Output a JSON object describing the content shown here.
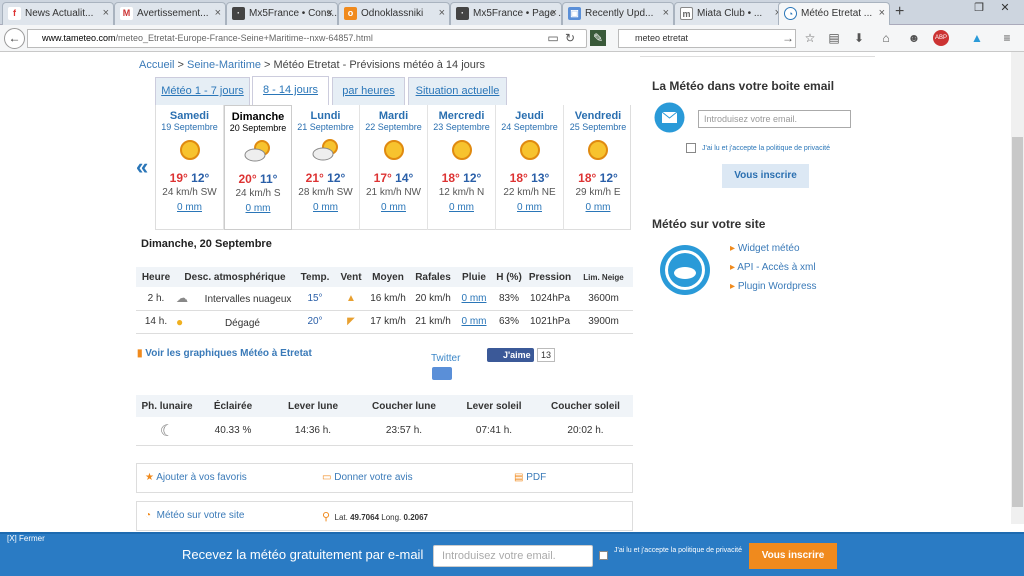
{
  "browser": {
    "tabs": [
      {
        "label": "News Actualit...",
        "icon": "news-icon",
        "color": "#d33"
      },
      {
        "label": "Avertissement...",
        "icon": "gmail-icon",
        "color": "#c33"
      },
      {
        "label": "Mx5France • Cons...",
        "icon": "mx5-icon",
        "color": "#444"
      },
      {
        "label": "Odnoklassniki",
        "icon": "ok-icon",
        "color": "#f08a1d"
      },
      {
        "label": "Mx5France • Page ...",
        "icon": "mx5-icon",
        "color": "#444"
      },
      {
        "label": "Recently Upd...",
        "icon": "photo-icon",
        "color": "#5a8fd8"
      },
      {
        "label": "Miata Club • ...",
        "icon": "mazda-icon",
        "color": "#666"
      },
      {
        "label": "Météo Etretat ...",
        "icon": "meteo-icon",
        "color": "#2a76b8"
      }
    ],
    "url_host": "www.tameteo.com",
    "url_path": "/meteo_Etretat-Europe-France-Seine+Maritime--nxw-64857.html",
    "search_value": "meteo etretat"
  },
  "breadcrumb": {
    "home": "Accueil",
    "sep": " > ",
    "region": "Seine-Maritime",
    "current": " > Météo Etretat - Prévisions météo à 14 jours"
  },
  "forecast_tabs": [
    "Météo 1 - 7 jours",
    "8 - 14 jours",
    "par heures",
    "Situation actuelle"
  ],
  "days": [
    {
      "name": "Samedi",
      "date": "19 Septembre",
      "max": "19°",
      "min": "12°",
      "wind": "24 km/h SW",
      "rain": "0 mm",
      "icon": "sun"
    },
    {
      "name": "Dimanche",
      "date": "20 Septembre",
      "max": "20°",
      "min": "11°",
      "wind": "24 km/h S",
      "rain": "0 mm",
      "icon": "sun-cloud"
    },
    {
      "name": "Lundi",
      "date": "21 Septembre",
      "max": "21°",
      "min": "12°",
      "wind": "28 km/h SW",
      "rain": "0 mm",
      "icon": "sun-cloud"
    },
    {
      "name": "Mardi",
      "date": "22 Septembre",
      "max": "17°",
      "min": "14°",
      "wind": "21 km/h NW",
      "rain": "0 mm",
      "icon": "sun"
    },
    {
      "name": "Mercredi",
      "date": "23 Septembre",
      "max": "18°",
      "min": "12°",
      "wind": "12 km/h N",
      "rain": "0 mm",
      "icon": "sun"
    },
    {
      "name": "Jeudi",
      "date": "24 Septembre",
      "max": "18°",
      "min": "13°",
      "wind": "22 km/h NE",
      "rain": "0 mm",
      "icon": "sun"
    },
    {
      "name": "Vendredi",
      "date": "25 Septembre",
      "max": "18°",
      "min": "12°",
      "wind": "29 km/h E",
      "rain": "0 mm",
      "icon": "sun"
    }
  ],
  "detail_title": "Dimanche, 20 Septembre",
  "detail_headers": [
    "Heure",
    "Desc. atmosphérique",
    "Temp.",
    "Vent",
    "Moyen",
    "Rafales",
    "Pluie",
    "H (%)",
    "Pression",
    "Lim. Neige"
  ],
  "detail_rows": [
    {
      "hour": "2 h.",
      "desc": "Intervalles nuageux",
      "temp": "15°",
      "avg": "16 km/h",
      "gust": "20 km/h",
      "rain": "0 mm",
      "hum": "83%",
      "press": "1024hPa",
      "snow": "3600m"
    },
    {
      "hour": "14 h.",
      "desc": "Dégagé",
      "temp": "20°",
      "avg": "17 km/h",
      "gust": "21 km/h",
      "rain": "0 mm",
      "hum": "63%",
      "press": "1021hPa",
      "snow": "3900m"
    }
  ],
  "graphs_link": "Voir les graphiques Météo à Etretat",
  "social": {
    "twitter": "Twitter",
    "fb": "J'aime",
    "fb_count": "13"
  },
  "moon_headers": [
    "Ph. lunaire",
    "Éclairée",
    "Lever lune",
    "Coucher lune",
    "Lever soleil",
    "Coucher soleil"
  ],
  "moon_row": {
    "lit": "40.33 %",
    "moonrise": "14:36 h.",
    "moonset": "23:57 h.",
    "sunrise": "07:41 h.",
    "sunset": "20:02 h."
  },
  "actions": {
    "fav": "Ajouter à vos favoris",
    "review": "Donner votre avis",
    "pdf": "PDF",
    "site": "Météo sur votre site",
    "lat_label": "Lat.",
    "lat": "49.7064",
    "long_label": "Long.",
    "long": "0.2067"
  },
  "email_box": {
    "title": "La Météo dans votre boite email",
    "placeholder": "Introduisez votre email.",
    "legal": "J'ai lu et j'accepte la politique de privacité",
    "button": "Vous inscrire"
  },
  "site_box": {
    "title": "Météo sur votre site",
    "links": [
      "Widget météo",
      "API - Accès à xml",
      "Plugin Wordpress"
    ]
  },
  "banner": {
    "close": "[X] Fermer",
    "text": "Recevez la météo gratuitement par e-mail",
    "placeholder": "Introduisez votre email.",
    "legal": "J'ai lu et j'accepte la politique de privacité",
    "button": "Vous inscrire"
  }
}
